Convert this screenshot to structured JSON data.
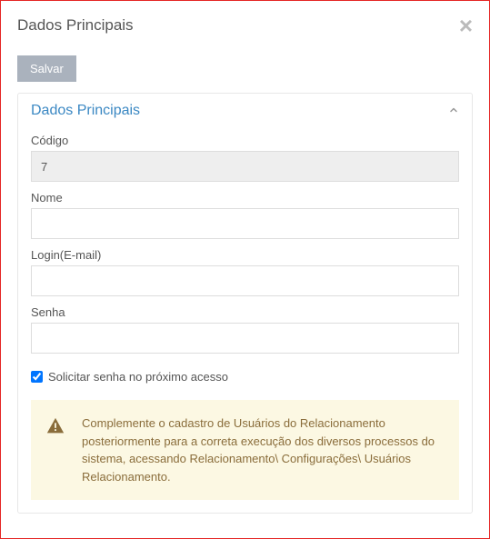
{
  "modal": {
    "title": "Dados Principais",
    "close_icon": "×"
  },
  "toolbar": {
    "save_label": "Salvar"
  },
  "panel": {
    "title": "Dados Principais"
  },
  "form": {
    "codigo_label": "Código",
    "codigo_value": "7",
    "nome_label": "Nome",
    "nome_value": "",
    "login_label": "Login(E-mail)",
    "login_value": "",
    "senha_label": "Senha",
    "senha_value": "",
    "solicitar_label": "Solicitar senha no próximo acesso",
    "solicitar_checked": true
  },
  "alert": {
    "text": "Complemente o cadastro de Usuários do Relacionamento posteriormente para a correta execução dos diversos processos do sistema, acessando Relacionamento\\ Configurações\\ Usuários Relacionamento."
  }
}
